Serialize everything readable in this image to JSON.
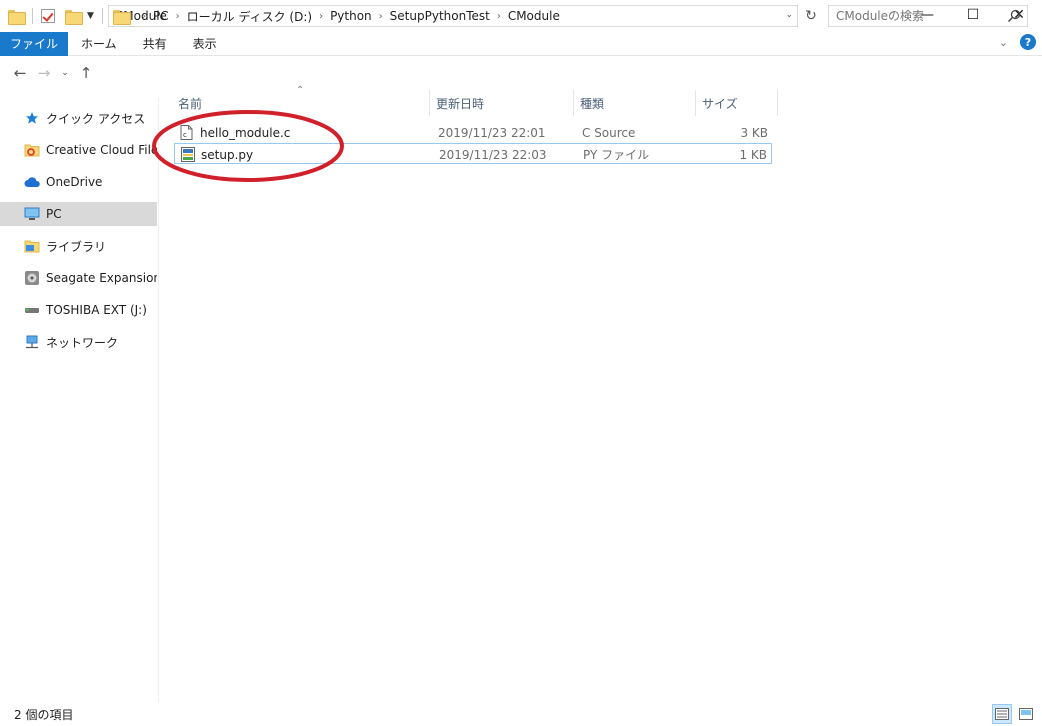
{
  "window": {
    "title": "CModule",
    "minimize_glyph": "—",
    "maximize_glyph": "☐",
    "close_glyph": "✕"
  },
  "ribbon": {
    "tabs": [
      "ファイル",
      "ホーム",
      "共有",
      "表示"
    ],
    "help_glyph": "?"
  },
  "address": {
    "crumbs": [
      "PC",
      "ローカル ディスク (D:)",
      "Python",
      "SetupPythonTest",
      "CModule"
    ],
    "search_placeholder": "CModuleの検索"
  },
  "sidebar": {
    "items": [
      {
        "label": "クイック アクセス",
        "icon": "star-icon"
      },
      {
        "label": "Creative Cloud Files",
        "icon": "creative-cloud-icon"
      },
      {
        "label": "OneDrive",
        "icon": "cloud-icon"
      },
      {
        "label": "PC",
        "icon": "monitor-icon",
        "selected": true
      },
      {
        "label": "ライブラリ",
        "icon": "library-icon"
      },
      {
        "label": "Seagate Expansion Dr",
        "icon": "drive-icon"
      },
      {
        "label": "TOSHIBA EXT (J:)",
        "icon": "usb-drive-icon"
      },
      {
        "label": "ネットワーク",
        "icon": "network-icon"
      }
    ]
  },
  "columns": {
    "name": "名前",
    "date": "更新日時",
    "type": "種類",
    "size": "サイズ"
  },
  "files": [
    {
      "name": "hello_module.c",
      "date": "2019/11/23 22:01",
      "type": "C Source",
      "size": "3 KB",
      "icon": "c-source-file-icon"
    },
    {
      "name": "setup.py",
      "date": "2019/11/23 22:03",
      "type": "PY ファイル",
      "size": "1 KB",
      "icon": "python-file-icon",
      "selected": true
    }
  ],
  "status": {
    "item_count": "2 個の項目"
  },
  "colors": {
    "accent": "#1979ca",
    "annotation": "#d0202a",
    "selection_border": "#99c9ef"
  }
}
